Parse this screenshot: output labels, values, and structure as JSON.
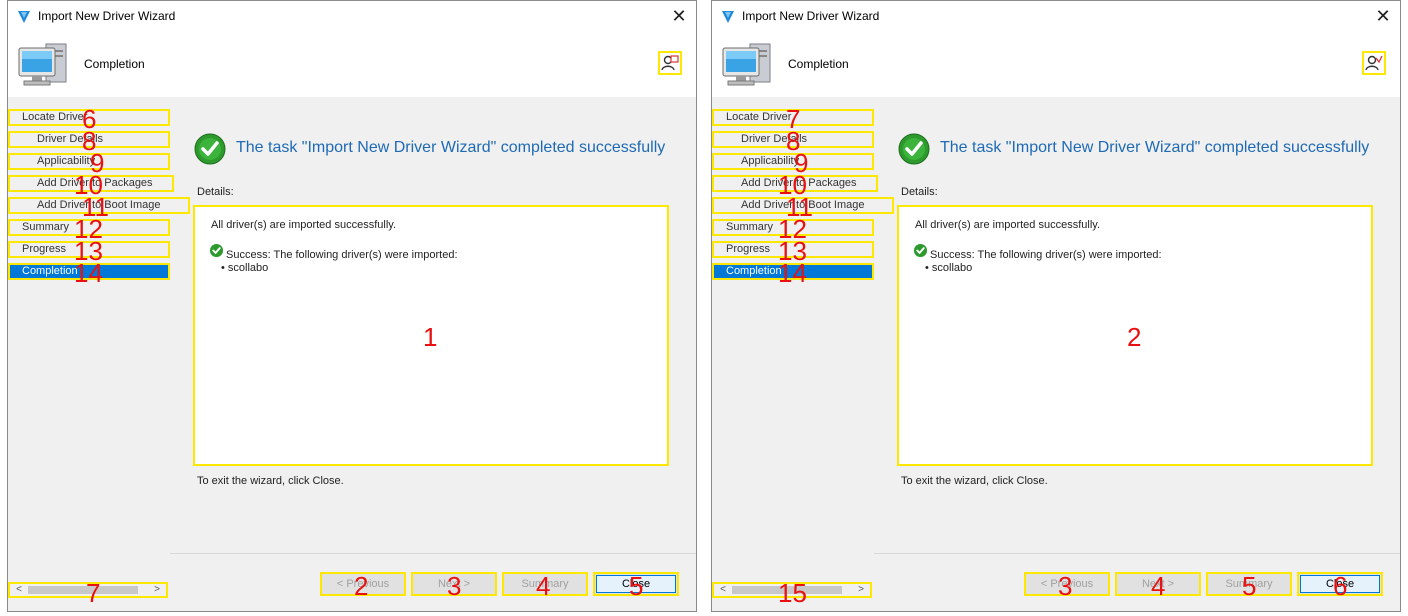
{
  "colors": {
    "accent": "#0078d7",
    "highlight": "#ffe800",
    "marker": "#e81010",
    "headline": "#1f6ab4"
  },
  "windows": [
    {
      "title": "Import New Driver Wizard",
      "header": "Completion",
      "nav": [
        "Locate Driver",
        "Driver Details",
        "Applicability",
        "Add Driver to Packages",
        "Add Driver to Boot Image",
        "Summary",
        "Progress",
        "Completion"
      ],
      "nav_marks": [
        "6",
        "8",
        "9",
        "10",
        "11",
        "12",
        "13",
        "14"
      ],
      "scroll_mark": "7",
      "headline": "The task \"Import New Driver Wizard\" completed successfully",
      "details_label": "Details:",
      "details_line1": "All driver(s) are imported successfully.",
      "details_line2": "Success: The following driver(s) were imported:",
      "details_item": "scollabo",
      "box_mark": "1",
      "exit_text": "To exit the wizard, click Close.",
      "buttons": [
        "< Previous",
        "Next >",
        "Summary",
        "Close"
      ],
      "button_marks": [
        "2",
        "3",
        "4",
        "5"
      ]
    },
    {
      "title": "Import New Driver Wizard",
      "header": "Completion",
      "nav": [
        "Locate Driver",
        "Driver Details",
        "Applicability",
        "Add Driver to Packages",
        "Add Driver to Boot Image",
        "Summary",
        "Progress",
        "Completion"
      ],
      "nav_marks": [
        "7",
        "8",
        "9",
        "10",
        "11",
        "12",
        "13",
        "14"
      ],
      "scroll_mark": "15",
      "headline": "The task \"Import New Driver Wizard\" completed successfully",
      "details_label": "Details:",
      "details_line1": "All driver(s) are imported successfully.",
      "details_line2": "Success: The following driver(s) were imported:",
      "details_item": "scollabo",
      "box_mark": "2",
      "exit_text": "To exit the wizard, click Close.",
      "buttons": [
        "< Previous",
        "Next >",
        "Summary",
        "Close"
      ],
      "button_marks": [
        "3",
        "4",
        "5",
        "6"
      ]
    }
  ]
}
